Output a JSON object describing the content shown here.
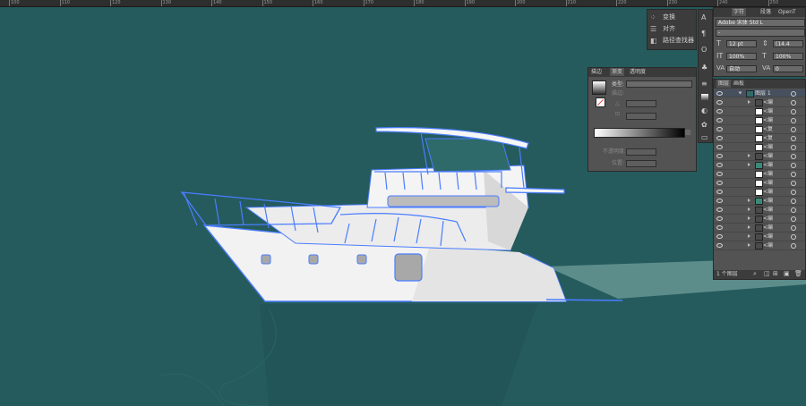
{
  "ruler": {
    "ticks": [
      "100",
      "110",
      "120",
      "130",
      "140",
      "150",
      "160",
      "170",
      "180",
      "190",
      "200",
      "210",
      "220",
      "230",
      "240",
      "250",
      "260"
    ]
  },
  "menu": {
    "items": [
      {
        "label": "变换"
      },
      {
        "label": "对齐"
      },
      {
        "label": "路径查找器"
      }
    ]
  },
  "gradient": {
    "tabs": [
      "描边",
      "渐变",
      "透明度"
    ],
    "type_label": "类型:",
    "stroke_label": "描边:",
    "angle_label": "△",
    "ratio_label": "⊡",
    "opacity_label": "不透明度:",
    "position_label": "位置:"
  },
  "character": {
    "tabs": [
      "字符",
      "段落",
      "OpenT"
    ],
    "font_name": "Adobe 宋体 Std L",
    "font_style": "-",
    "size": "12 pt",
    "leading": "(14.4",
    "vscale": "100%",
    "hscale": "100%",
    "kerning": "自动",
    "tracking": "0"
  },
  "layers": {
    "tabs": [
      "图层",
      "画板"
    ],
    "top_layer": "图层 1",
    "items": [
      {
        "name": "<编",
        "thumb": "dark"
      },
      {
        "name": "<编",
        "thumb": "white"
      },
      {
        "name": "<编",
        "thumb": "white"
      },
      {
        "name": "<复",
        "thumb": "white"
      },
      {
        "name": "<复",
        "thumb": "white"
      },
      {
        "name": "<编",
        "thumb": "white"
      },
      {
        "name": "<编",
        "thumb": "dark"
      },
      {
        "name": "<编",
        "thumb": "teal"
      },
      {
        "name": "<编",
        "thumb": "white"
      },
      {
        "name": "<编",
        "thumb": "white"
      },
      {
        "name": "<编",
        "thumb": "white"
      },
      {
        "name": "<编",
        "thumb": "teal"
      },
      {
        "name": "<编",
        "thumb": "dark"
      },
      {
        "name": "<编",
        "thumb": "dark"
      },
      {
        "name": "<编",
        "thumb": "dark"
      },
      {
        "name": "<编",
        "thumb": "dark"
      },
      {
        "name": "<编",
        "thumb": "dark"
      }
    ],
    "footer": "1 个图层"
  },
  "colors": {
    "canvas": "#255b5d",
    "selection": "#4a7dff"
  }
}
